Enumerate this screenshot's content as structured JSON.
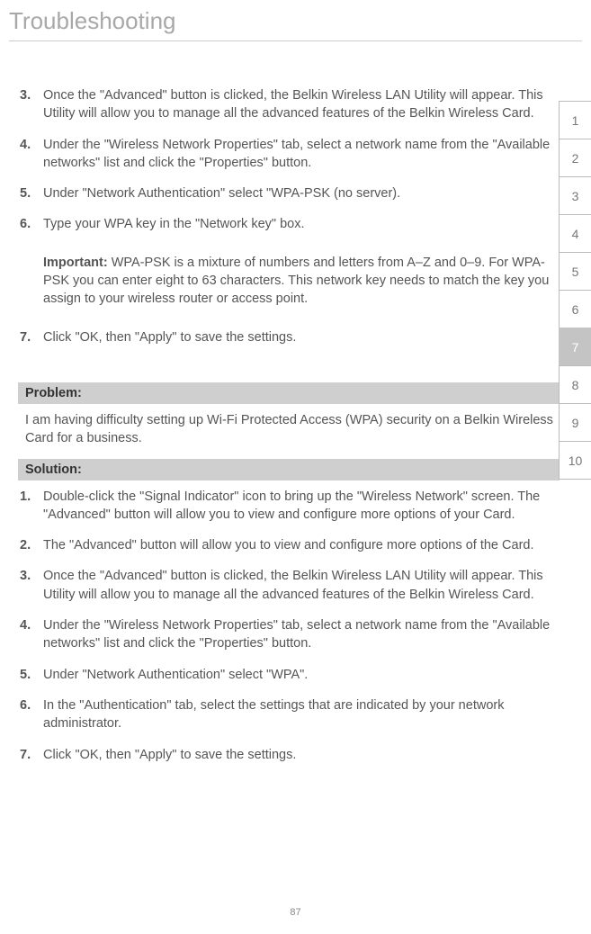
{
  "page_title": "Troubleshooting",
  "sidebar": {
    "tabs": [
      "1",
      "2",
      "3",
      "4",
      "5",
      "6",
      "7",
      "8",
      "9",
      "10"
    ],
    "active_index": 6
  },
  "top_steps": [
    {
      "num": "3.",
      "text": "Once the \"Advanced\" button is clicked, the Belkin Wireless LAN Utility will appear. This Utility will allow you to manage all the advanced features of the Belkin Wireless Card."
    },
    {
      "num": "4.",
      "text": "Under the \"Wireless Network Properties\" tab, select a network name from the \"Available networks\" list and click the \"Properties\" button."
    },
    {
      "num": "5.",
      "text": "Under \"Network Authentication\" select \"WPA-PSK (no server)."
    },
    {
      "num": "6.",
      "text": "Type your WPA key in the \"Network key\" box."
    }
  ],
  "important": {
    "label": "Important:",
    "text": " WPA-PSK is a mixture of numbers and letters from A–Z and 0–9. For WPA-PSK you can enter eight to 63 characters. This network key needs to match the key you assign to your wireless router or access point."
  },
  "step7": {
    "num": "7.",
    "text": "Click \"OK, then \"Apply\" to save the settings."
  },
  "problem": {
    "header": "Problem:",
    "text": "I am having difficulty setting up Wi-Fi Protected Access (WPA) security on a Belkin Wireless Card for a business."
  },
  "solution": {
    "header": "Solution:",
    "steps": [
      {
        "num": "1.",
        "text": "Double-click the \"Signal Indicator\" icon to bring up the \"Wireless Network\" screen. The \"Advanced\" button will allow you to view and configure more options of your Card."
      },
      {
        "num": "2.",
        "text": "The \"Advanced\" button will allow you to view and configure more options of the Card."
      },
      {
        "num": "3.",
        "text": "Once the \"Advanced\" button is clicked, the Belkin Wireless LAN Utility will appear. This Utility will allow you to manage all the advanced features of the Belkin Wireless Card."
      },
      {
        "num": "4.",
        "text": "Under the \"Wireless Network Properties\" tab, select a network name from the \"Available networks\" list and click the \"Properties\" button."
      },
      {
        "num": "5.",
        "text": "Under \"Network Authentication\" select \"WPA\"."
      },
      {
        "num": "6.",
        "text": "In the \"Authentication\" tab, select the settings that are indicated by your network administrator."
      },
      {
        "num": "7.",
        "text": "Click \"OK, then \"Apply\" to save the settings."
      }
    ]
  },
  "page_number": "87"
}
